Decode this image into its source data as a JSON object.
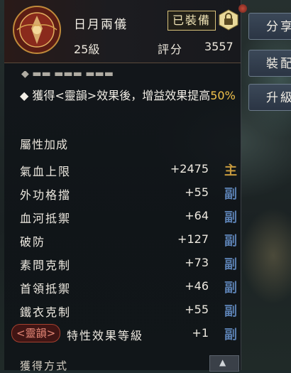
{
  "item": {
    "name": "日月兩儀",
    "level": "25級",
    "score_label": "評分",
    "score_value": "3557",
    "equip_status": "已裝備"
  },
  "side_buttons": {
    "share": "分享",
    "equip": "裝配",
    "upgrade": "升級"
  },
  "effect": {
    "prefix": "◆ 獲得<靈韻>效果後，增益效果提高",
    "highlight": "50%"
  },
  "section_title": "屬性加成",
  "attributes": [
    {
      "name": "氣血上限",
      "value": "+2475",
      "tag": "主"
    },
    {
      "name": "外功格擋",
      "value": "+55",
      "tag": "副"
    },
    {
      "name": "血河抵禦",
      "value": "+64",
      "tag": "副"
    },
    {
      "name": "破防",
      "value": "+127",
      "tag": "副"
    },
    {
      "name": "素問克制",
      "value": "+73",
      "tag": "副"
    },
    {
      "name": "首領抵禦",
      "value": "+46",
      "tag": "副"
    },
    {
      "name": "鐵衣克制",
      "value": "+55",
      "tag": "副"
    }
  ],
  "lingyun_row": {
    "badge": "<靈韻>",
    "label": "特性效果等級",
    "value": "+1",
    "tag": "副"
  },
  "bottom_label": "獲得方式",
  "colors": {
    "highlight": "#f1c24c",
    "main_tag": "#c79a3e",
    "sub_tag": "#5a7fb0",
    "badge_border": "#d9c37a",
    "lingyun": "#e48676"
  }
}
